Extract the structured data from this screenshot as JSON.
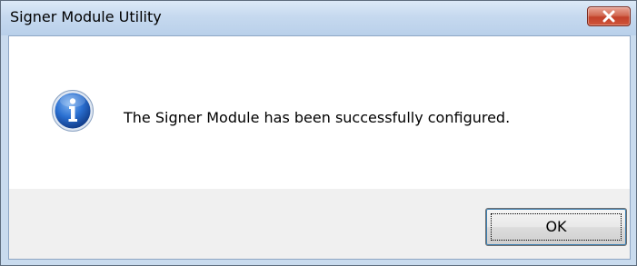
{
  "dialog": {
    "title": "Signer Module Utility",
    "message": "The Signer Module has been successfully configured.",
    "icon": "info-icon",
    "buttons": {
      "close_icon": "close-icon",
      "ok_label": "OK"
    }
  },
  "colors": {
    "close_button": "#c2412a",
    "info_icon": "#1f5fbf",
    "title_bar": "#c6d9ef"
  }
}
